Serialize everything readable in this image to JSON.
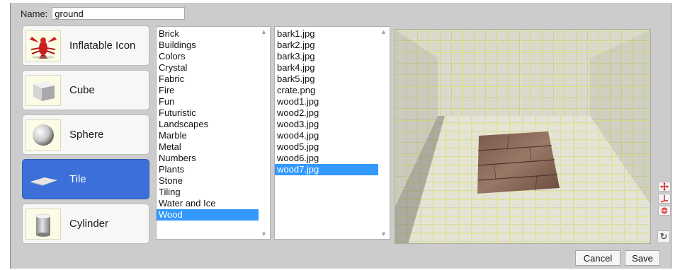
{
  "name_field": {
    "label": "Name:",
    "value": "ground"
  },
  "shapes": [
    {
      "label": "Inflatable Icon",
      "icon": "lobster-icon",
      "selected": false
    },
    {
      "label": "Cube",
      "icon": "cube-icon",
      "selected": false
    },
    {
      "label": "Sphere",
      "icon": "sphere-icon",
      "selected": false
    },
    {
      "label": "Tile",
      "icon": "tile-icon",
      "selected": true
    },
    {
      "label": "Cylinder",
      "icon": "cylinder-icon",
      "selected": false
    }
  ],
  "categories": {
    "items": [
      "Brick",
      "Buildings",
      "Colors",
      "Crystal",
      "Fabric",
      "Fire",
      "Fun",
      "Futuristic",
      "Landscapes",
      "Marble",
      "Metal",
      "Numbers",
      "Plants",
      "Stone",
      "Tiling",
      "Water and Ice",
      "Wood"
    ],
    "selected": "Wood"
  },
  "textures": {
    "items": [
      "bark1.jpg",
      "bark2.jpg",
      "bark3.jpg",
      "bark4.jpg",
      "bark5.jpg",
      "crate.png",
      "wood1.jpg",
      "wood2.jpg",
      "wood3.jpg",
      "wood4.jpg",
      "wood5.jpg",
      "wood6.jpg",
      "wood7.jpg"
    ],
    "selected": "wood7.jpg"
  },
  "tools": [
    "move-icon",
    "rotate-axis-icon",
    "orbit-icon"
  ],
  "refresh": {
    "icon": "refresh-icon",
    "glyph": "↻"
  },
  "actions": {
    "cancel": "Cancel",
    "save": "Save"
  },
  "colors": {
    "selection": "#3399ff",
    "shape_selected": "#3c70d8",
    "panel_bg": "#cccccc"
  }
}
